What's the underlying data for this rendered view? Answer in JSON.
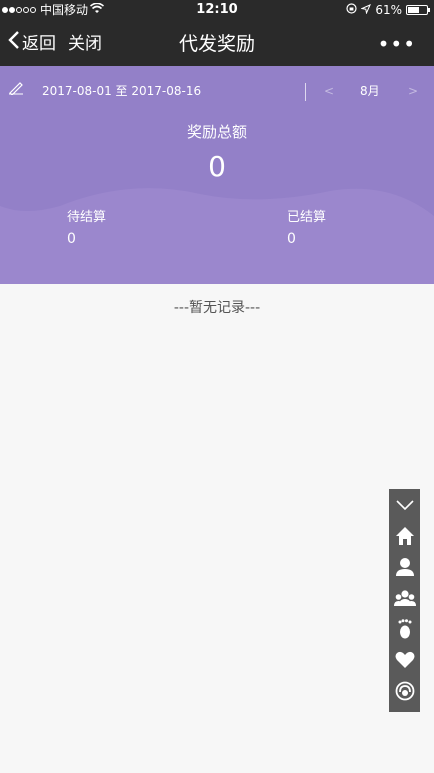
{
  "status": {
    "carrier": "中国移动",
    "time": "12:10",
    "battery": "61%",
    "battery_level": 0.61
  },
  "nav": {
    "back_label": "返回",
    "close_label": "关闭",
    "title": "代发奖励",
    "more_label": "•••"
  },
  "summary": {
    "date_range": "2017-08-01 至 2017-08-16",
    "month": "8月",
    "prev": "<",
    "next": ">",
    "total_label": "奖励总额",
    "total_value": "0",
    "pending_label": "待结算",
    "pending_value": "0",
    "settled_label": "已结算",
    "settled_value": "0"
  },
  "empty_text": "---暂无记录---",
  "toolbar_icons": [
    "collapse-icon",
    "home-icon",
    "user-icon",
    "group-icon",
    "footprint-icon",
    "heart-icon",
    "support-icon"
  ],
  "colors": {
    "header_purple": "#9b87cd",
    "topbar": "#2a2a2a",
    "toolbar": "#5a5a5a"
  }
}
